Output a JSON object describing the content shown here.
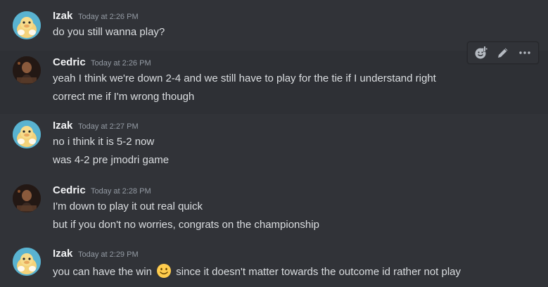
{
  "messages": [
    {
      "author": "Izak",
      "timestamp": "Today at 2:26 PM",
      "lines": [
        "do you still wanna play?"
      ]
    },
    {
      "author": "Cedric",
      "timestamp": "Today at 2:26 PM",
      "lines": [
        "yeah I think we're down 2-4 and we still have to play for the tie if I understand right",
        "correct me if I'm wrong though"
      ]
    },
    {
      "author": "Izak",
      "timestamp": "Today at 2:27 PM",
      "lines": [
        "no i think it is 5-2 now",
        "was 4-2 pre jmodri game"
      ]
    },
    {
      "author": "Cedric",
      "timestamp": "Today at 2:28 PM",
      "lines": [
        "I'm down to play it out real quick",
        "but if you don't no worries, congrats on the championship"
      ]
    },
    {
      "author": "Izak",
      "timestamp": "Today at 2:29 PM",
      "lines": [
        "you can have the win",
        "since it doesn't matter towards the outcome id rather not play"
      ],
      "emoji": "slightly-smiling-face-emoji"
    }
  ],
  "toolbar": {
    "icons": [
      "add-reaction-icon",
      "edit-icon",
      "more-options-icon"
    ]
  },
  "colors": {
    "background": "#313338",
    "hover_background": "#2e3035",
    "username": "#f2f3f5",
    "text": "#dbdee1",
    "timestamp": "#949ba4"
  }
}
